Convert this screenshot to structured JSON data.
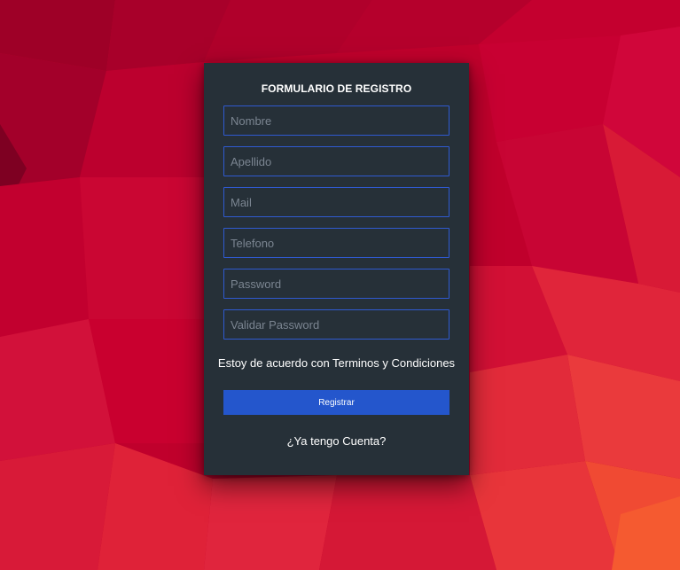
{
  "background": {
    "colors": [
      "#a8002a",
      "#c40030",
      "#d81a35",
      "#e83a3a",
      "#f05030"
    ]
  },
  "form": {
    "title": "FORMULARIO DE REGISTRO",
    "fields": {
      "nombre": {
        "placeholder": "Nombre",
        "value": ""
      },
      "apellido": {
        "placeholder": "Apellido",
        "value": ""
      },
      "mail": {
        "placeholder": "Mail",
        "value": ""
      },
      "telefono": {
        "placeholder": "Telefono",
        "value": ""
      },
      "password": {
        "placeholder": "Password",
        "value": ""
      },
      "validar_password": {
        "placeholder": "Validar Password",
        "value": ""
      }
    },
    "terms_label": "Estoy de acuerdo con Terminos y Condiciones",
    "submit_label": "Registrar",
    "account_link": "¿Ya tengo Cuenta?"
  },
  "colors": {
    "card_bg": "#263038",
    "field_border": "#2f5ad1",
    "button_bg": "#2456cc",
    "text": "#ffffff"
  }
}
